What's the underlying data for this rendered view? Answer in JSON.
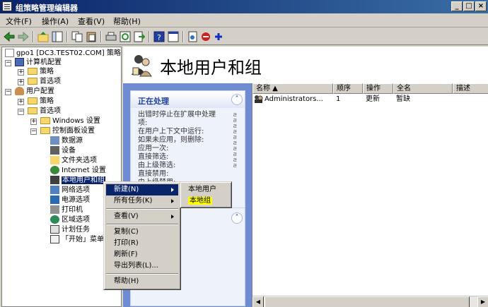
{
  "window": {
    "title": "组策略管理编辑器",
    "min": "_",
    "max": "□",
    "close": "×"
  },
  "menubar": [
    "文件(F)",
    "操作(A)",
    "查看(V)",
    "帮助(H)"
  ],
  "tree": {
    "root": "gpo1 [DC3.TEST02.COM] 策略",
    "computer_config": "计算机配置",
    "c_policy": "策略",
    "c_pref": "首选项",
    "user_config": "用户配置",
    "u_policy": "策略",
    "u_pref": "首选项",
    "windows_settings": "Windows 设置",
    "control_panel": "控制面板设置",
    "items": [
      "数据源",
      "设备",
      "文件夹选项",
      "Internet 设置",
      "本地用户和组",
      "网络选项",
      "电源选项",
      "打印机",
      "区域选项",
      "计划任务",
      "「开始」菜单"
    ]
  },
  "hero": {
    "title": "本地用户和组"
  },
  "task_panel": {
    "title": "正在处理",
    "body": [
      "出错时停止在扩展中处理",
      "项:",
      "在用户上下文中运行:",
      "如果未应用，则删除:",
      "应用一次:",
      "直接筛选:",
      "由上级筛选:",
      "直接禁用:",
      "由上级禁用:"
    ],
    "side_chars": "ㄹㄹㄹㄹㄹㄹㄹㄹㄹㄹ"
  },
  "list": {
    "columns": [
      "名称 ▲",
      "顺序",
      "操作",
      "全名",
      "描述"
    ],
    "rows": [
      {
        "name": "Administrators...",
        "order": "1",
        "action": "更新",
        "fullname": "暂缺",
        "desc": ""
      }
    ]
  },
  "context_menu": {
    "items": [
      "新建(N)",
      "所有任务(K)",
      "查看(V)",
      "复制(C)",
      "打印(R)",
      "刷新(F)",
      "导出列表(L)...",
      "帮助(H)"
    ]
  },
  "submenu": {
    "items": [
      "本地用户",
      "本地组"
    ]
  },
  "colors": {
    "titlebar_left": "#0a246a",
    "titlebar_right": "#3a6ea5",
    "panel_bg": "#6f8bd1",
    "highlight": "#0a246a",
    "marker": "#ffff00"
  }
}
